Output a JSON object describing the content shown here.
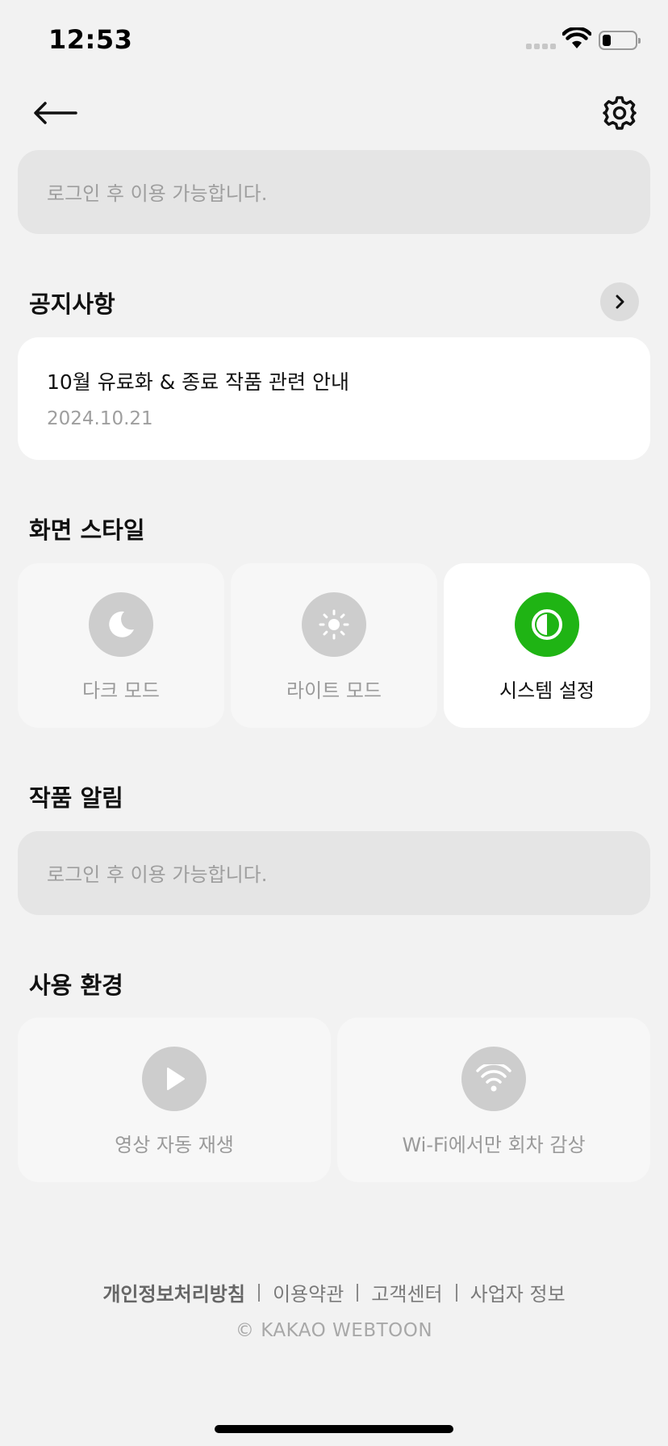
{
  "status_bar": {
    "time": "12:53",
    "battery_level": 0.25
  },
  "nav": {
    "back_icon": "arrow-left-icon",
    "settings_icon": "gear-icon"
  },
  "login_notice": {
    "text": "로그인 후 이용 가능합니다."
  },
  "notices": {
    "title": "공지사항",
    "more_icon": "chevron-right-icon",
    "items": [
      {
        "title": "10월 유료화 & 종료 작품 관련 안내",
        "date": "2024.10.21"
      }
    ]
  },
  "display_style": {
    "title": "화면 스타일",
    "options": [
      {
        "label": "다크 모드",
        "icon": "moon-icon",
        "selected": false
      },
      {
        "label": "라이트 모드",
        "icon": "sun-icon",
        "selected": false
      },
      {
        "label": "시스템 설정",
        "icon": "contrast-icon",
        "selected": true
      }
    ],
    "accent_color": "#1fb414"
  },
  "work_alerts": {
    "title": "작품 알림",
    "text": "로그인 후 이용 가능합니다."
  },
  "usage_env": {
    "title": "사용 환경",
    "options": [
      {
        "label": "영상 자동 재생",
        "icon": "play-icon"
      },
      {
        "label": "Wi-Fi에서만 회차 감상",
        "icon": "wifi-icon"
      }
    ]
  },
  "footer": {
    "links": [
      "개인정보처리방침",
      "이용약관",
      "고객센터",
      "사업자 정보"
    ],
    "copyright": "© KAKAO WEBTOON"
  }
}
